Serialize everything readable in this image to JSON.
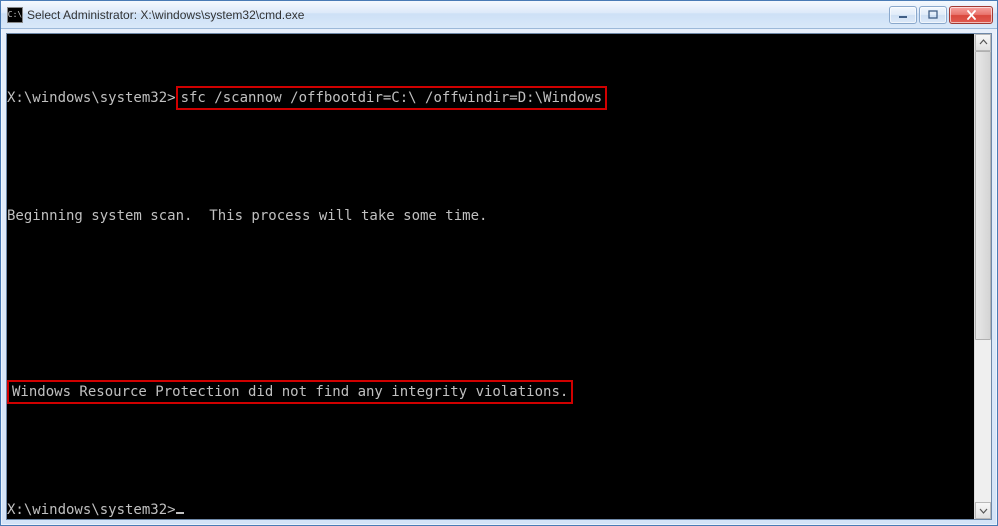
{
  "window": {
    "title": "Select Administrator: X:\\windows\\system32\\cmd.exe",
    "icon_label": "C:\\"
  },
  "terminal": {
    "prompt1_prefix": "X:\\windows\\system32>",
    "command": "sfc /scannow /offbootdir=C:\\ /offwindir=D:\\Windows",
    "scan_msg": "Beginning system scan.  This process will take some time.",
    "result_msg": "Windows Resource Protection did not find any integrity violations.",
    "prompt2": "X:\\windows\\system32>"
  },
  "controls": {
    "minimize_tooltip": "Minimize",
    "maximize_tooltip": "Maximize",
    "close_tooltip": "Close"
  }
}
